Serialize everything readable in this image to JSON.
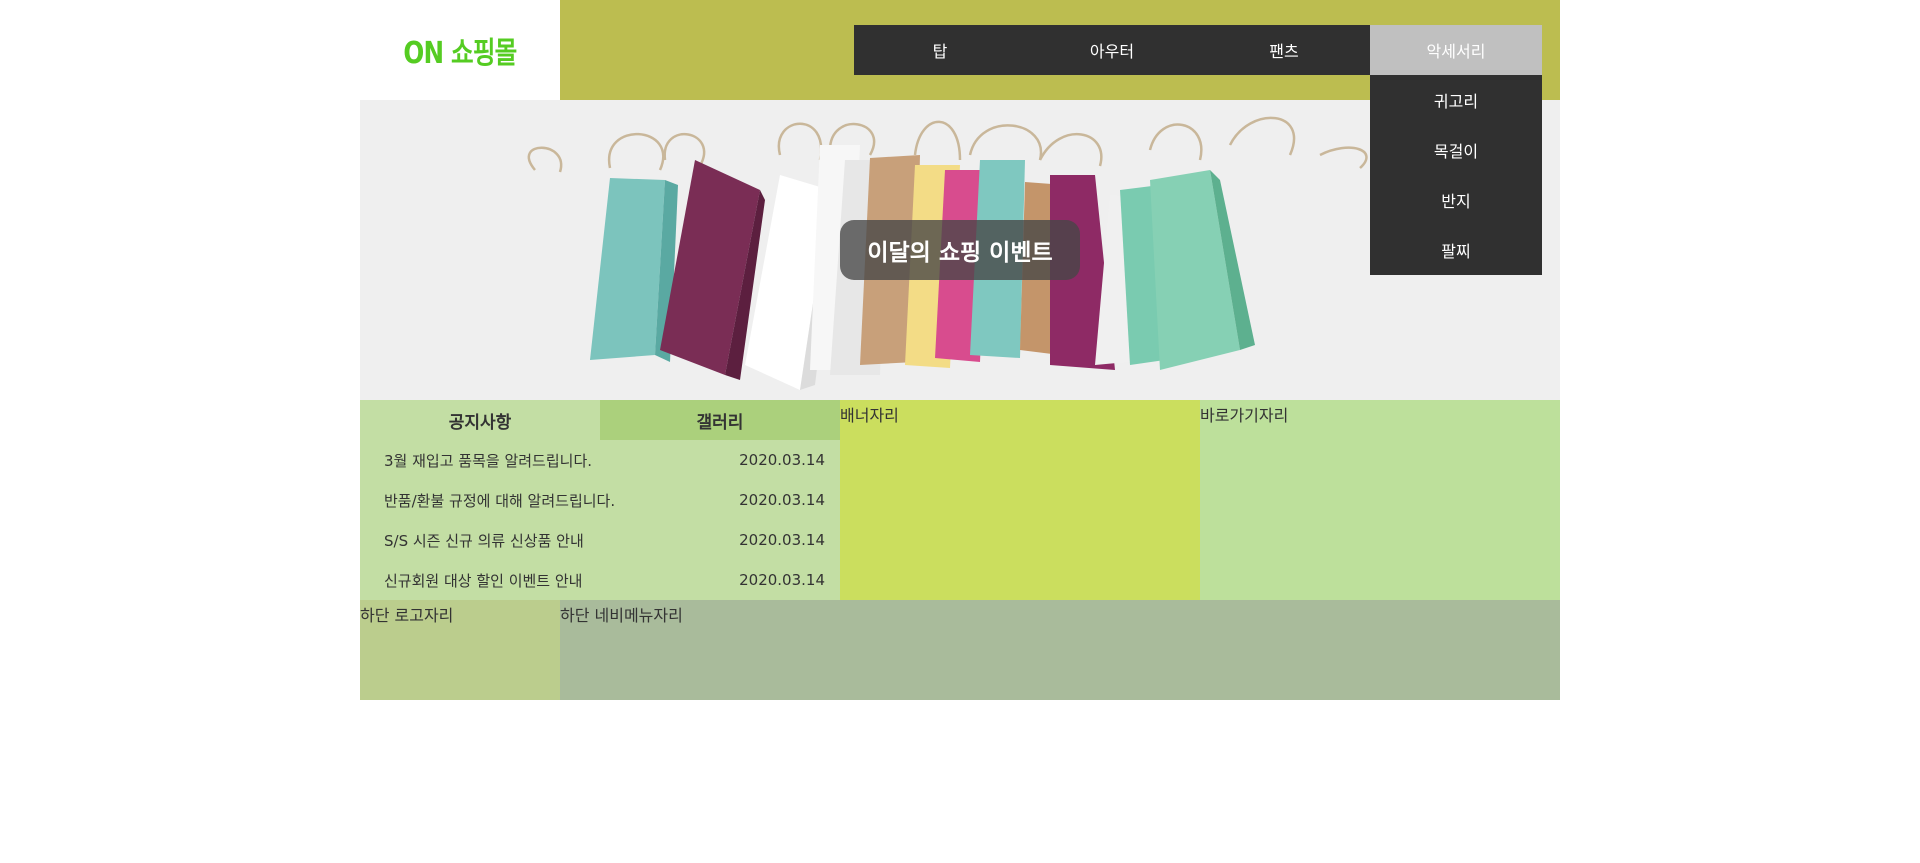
{
  "header": {
    "logo": "ON 쇼핑몰",
    "colors": {
      "logo": "#55cc22",
      "header_bar": "#bcbd50",
      "nav_bg": "#303030",
      "nav_active": "#c0c0c0"
    }
  },
  "nav": {
    "items": [
      {
        "label": "탑"
      },
      {
        "label": "아우터"
      },
      {
        "label": "팬츠"
      },
      {
        "label": "악세서리"
      }
    ],
    "active_index": 3,
    "submenu": [
      {
        "label": "귀고리"
      },
      {
        "label": "목걸이"
      },
      {
        "label": "반지"
      },
      {
        "label": "팔찌"
      }
    ]
  },
  "banner": {
    "title": "이달의 쇼핑 이벤트",
    "image": "shopping-bags-photo"
  },
  "notice": {
    "tabs": [
      {
        "label": "공지사항"
      },
      {
        "label": "갤러리"
      }
    ],
    "items": [
      {
        "title": "3월 재입고 품목을 알려드립니다.",
        "date": "2020.03.14"
      },
      {
        "title": "반품/환불 규정에 대해 알려드립니다.",
        "date": "2020.03.14"
      },
      {
        "title": "S/S 시즌 신규 의류 신상품 안내",
        "date": "2020.03.14"
      },
      {
        "title": "신규회원 대상 할인 이벤트 안내",
        "date": "2020.03.14"
      }
    ]
  },
  "slots": {
    "banner": "배너자리",
    "shortcut": "바로가기자리"
  },
  "footer": {
    "logo_slot": "하단 로고자리",
    "nav_slot": "하단 네비메뉴자리"
  }
}
